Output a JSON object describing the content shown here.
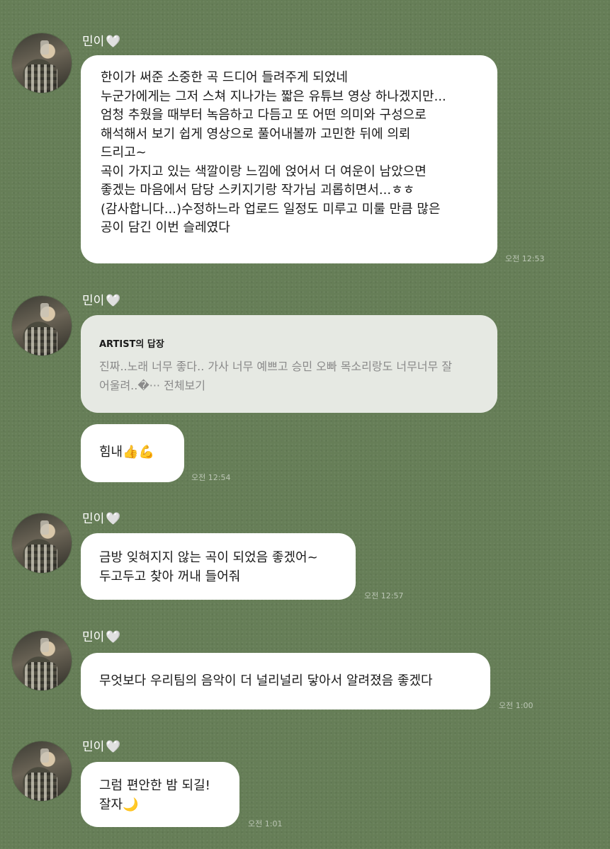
{
  "sender_name": "민이",
  "heart_glyph": "🤍",
  "messages": [
    {
      "lines": [
        "한이가 써준 소중한 곡 드디어 들려주게 되었네",
        "누군가에게는 그저 스쳐 지나가는 짧은 유튜브 영상 하나겠지만...",
        "엄청 추웠을 때부터 녹음하고 다듬고 또 어떤 의미와 구성으로",
        "해석해서 보기 쉽게 영상으로 풀어내볼까 고민한 뒤에 의뢰",
        "드리고~",
        "곡이 가지고 있는 색깔이랑 느낌에 얹어서 더 여운이 남았으면",
        "좋겠는 마음에서 담당 스키지기랑 작가님 괴롭히면서...ㅎㅎ",
        "(감사합니다...)수정하느라 업로드 일정도 미루고 미룰 만큼 많은",
        "공이 담긴 이번 슬레였다"
      ],
      "time": "오전 12:53"
    },
    {
      "reply_title": "ARTIST의 답장",
      "reply_lines": [
        "진짜..노래 너무 좋다.. 가사 너무 예쁘고 승민 오빠 목소리랑도 너무너무 잘",
        "어울려..�··· "
      ],
      "reply_more": "전체보기"
    },
    {
      "lines": [
        "힘내👍💪"
      ],
      "time": "오전 12:54"
    },
    {
      "lines": [
        "금방 잊혀지지 않는 곡이 되었음 좋겠어~",
        "두고두고 찾아 꺼내 들어줘"
      ],
      "time": "오전 12:57"
    },
    {
      "lines": [
        "무엇보다 우리팀의 음악이 더 널리널리 닿아서 알려졌음 좋겠다"
      ],
      "time": "오전 1:00"
    },
    {
      "lines": [
        "그럼 편안한 밤 되길!",
        "잘자🌙"
      ],
      "time": "오전 1:01"
    }
  ]
}
